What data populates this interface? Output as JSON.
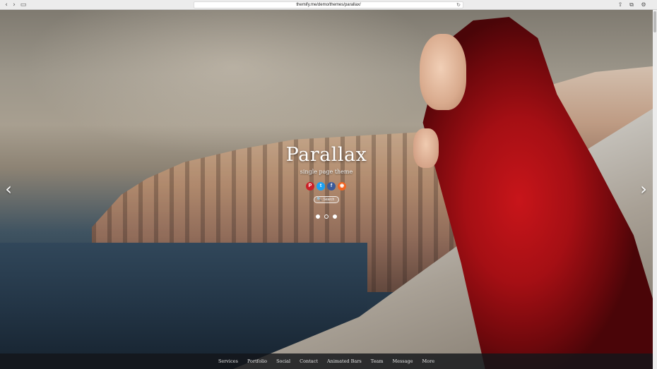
{
  "browser": {
    "url": "themify.me/demo/themes/parallax/",
    "back_icon": "‹",
    "forward_icon": "›",
    "sidebar_icon": "▭",
    "reload_icon": "↻",
    "share_icon": "⇧",
    "tabs_icon": "⧉",
    "settings_icon": "⚙"
  },
  "hero": {
    "title": "Parallax",
    "tagline": "single page theme",
    "prev_arrow": "‹",
    "next_arrow": "›"
  },
  "social": [
    {
      "name": "pinterest",
      "glyph": "P",
      "color": "#cb2027"
    },
    {
      "name": "twitter",
      "glyph": "t",
      "color": "#1da1f2"
    },
    {
      "name": "facebook",
      "glyph": "f",
      "color": "#3b5998"
    },
    {
      "name": "rss",
      "glyph": "◉",
      "color": "#f26522"
    }
  ],
  "search": {
    "icon": "🔍",
    "placeholder": "Search"
  },
  "slider": {
    "total": 3,
    "active": 3
  },
  "nav": {
    "items": [
      "Services",
      "Portfolio",
      "Social",
      "Contact",
      "Animated Bars",
      "Team",
      "Message",
      "More"
    ]
  }
}
